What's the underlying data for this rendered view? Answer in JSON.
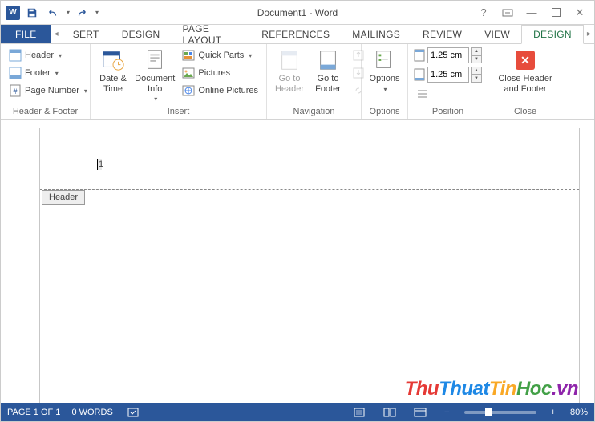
{
  "title": "Document1 - Word",
  "qat": {
    "word": "W"
  },
  "tabs": {
    "file": "FILE",
    "items": [
      "SERT",
      "DESIGN",
      "PAGE LAYOUT",
      "REFERENCES",
      "MAILINGS",
      "REVIEW",
      "VIEW"
    ],
    "contextual": "DESIGN"
  },
  "ribbon": {
    "header_footer": {
      "label": "Header & Footer",
      "header": "Header",
      "footer": "Footer",
      "page_number": "Page Number"
    },
    "insert": {
      "label": "Insert",
      "date_time": "Date &\nTime",
      "doc_info": "Document\nInfo",
      "quick_parts": "Quick Parts",
      "pictures": "Pictures",
      "online_pictures": "Online Pictures"
    },
    "navigation": {
      "label": "Navigation",
      "goto_header": "Go to\nHeader",
      "goto_footer": "Go to\nFooter"
    },
    "options": {
      "label": "Options",
      "options": "Options"
    },
    "position": {
      "label": "Position",
      "top": "1.25 cm",
      "bottom": "1.25 cm"
    },
    "close": {
      "label": "Close",
      "btn": "Close Header\nand Footer"
    }
  },
  "document": {
    "header_tag": "Header",
    "cursor_text": "1"
  },
  "statusbar": {
    "page": "PAGE 1 OF 1",
    "words": "0 WORDS",
    "zoom": "80%",
    "minus": "−",
    "plus": "+"
  },
  "watermark": {
    "t1": "Thu",
    "t2": "Thuat",
    "t3": "Tin",
    "t4": "Hoc",
    "t5": ".vn"
  }
}
